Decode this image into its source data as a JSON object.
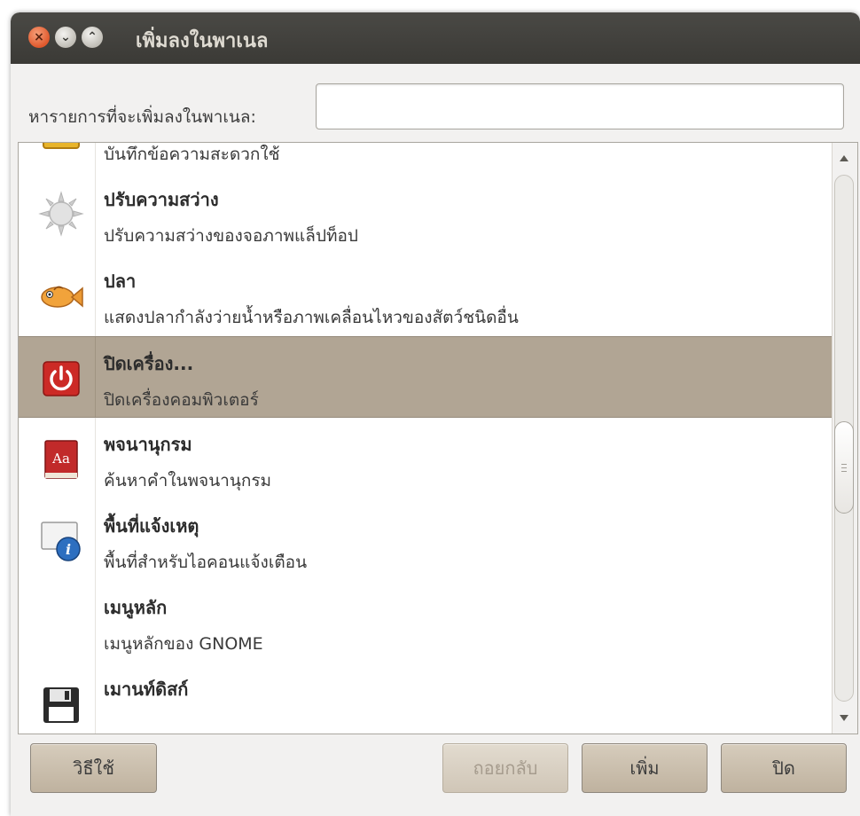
{
  "window": {
    "title": "เพิ่มลงในพาเนล",
    "close_glyph": "×",
    "minimize_glyph": "⌄",
    "maximize_glyph": "⌃"
  },
  "search": {
    "label": "หารายการที่จะเพิ่มลงในพาเนล:",
    "value": "",
    "placeholder": ""
  },
  "items": [
    {
      "icon": "sticky-notes-icon",
      "title": "",
      "description": "บันทึกข้อความสะดวกใช้"
    },
    {
      "icon": "brightness-sun-icon",
      "title": "ปรับความสว่าง",
      "description": "ปรับความสว่างของจอภาพแล็ปท็อป"
    },
    {
      "icon": "fish-icon",
      "title": "ปลา",
      "description": "แสดงปลากำลังว่ายน้ำหรือภาพเคลื่อนไหวของสัตว์ชนิดอื่น"
    },
    {
      "icon": "power-icon",
      "title": "ปิดเครื่อง...",
      "description": "ปิดเครื่องคอมพิวเตอร์",
      "selected": true
    },
    {
      "icon": "dictionary-icon",
      "title": "พจนานุกรม",
      "description": "ค้นหาคำในพจนานุกรม"
    },
    {
      "icon": "notification-area-icon",
      "title": "พื้นที่แจ้งเหตุ",
      "description": "พื้นที่สำหรับไอคอนแจ้งเตือน"
    },
    {
      "icon": "",
      "title": "เมนูหลัก",
      "description": "เมนูหลักของ GNOME"
    },
    {
      "icon": "floppy-disk-icon",
      "title": "เมานท์ดิสก์",
      "description": ""
    }
  ],
  "buttons": {
    "help": "วิธีใช้",
    "back": "ถอยกลับ",
    "add": "เพิ่ม",
    "close": "ปิด"
  },
  "colors": {
    "selection": "#b1a594",
    "titlebar": "#3c3b37",
    "power_red": "#cc2a26"
  }
}
